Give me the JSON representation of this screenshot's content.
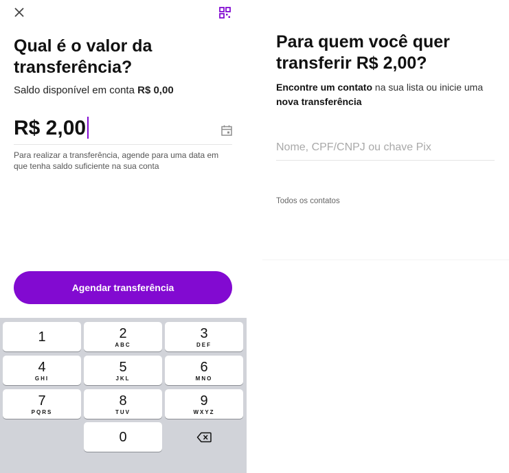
{
  "left": {
    "title_line1": "Qual é o valor da",
    "title_line2": "transferência?",
    "balance_label": "Saldo disponível em conta",
    "balance_value": "R$ 0,00",
    "amount": "R$ 2,00",
    "hint": "Para realizar a transferência, agende para uma data em que tenha saldo suficiente na sua conta",
    "schedule_button": "Agendar transferência"
  },
  "keypad": {
    "keys": [
      {
        "num": "1",
        "letters": ""
      },
      {
        "num": "2",
        "letters": "ABC"
      },
      {
        "num": "3",
        "letters": "DEF"
      },
      {
        "num": "4",
        "letters": "GHI"
      },
      {
        "num": "5",
        "letters": "JKL"
      },
      {
        "num": "6",
        "letters": "MNO"
      },
      {
        "num": "7",
        "letters": "PQRS"
      },
      {
        "num": "8",
        "letters": "TUV"
      },
      {
        "num": "9",
        "letters": "WXYZ"
      },
      {
        "num": "0",
        "letters": ""
      }
    ]
  },
  "right": {
    "title_line1": "Para quem você quer",
    "title_line2": "transferir R$ 2,00?",
    "sub_bold1": "Encontre um contato",
    "sub_text1": " na sua lista ou inicie uma ",
    "sub_bold2": "nova transferência",
    "search_placeholder": "Nome, CPF/CNPJ ou chave Pix",
    "contacts_label": "Todos os contatos"
  },
  "colors": {
    "accent": "#820ad1",
    "keypad_bg": "#d1d3d9"
  },
  "icons": [
    "close-icon",
    "qr-code-icon",
    "calendar-icon",
    "backspace-icon"
  ]
}
